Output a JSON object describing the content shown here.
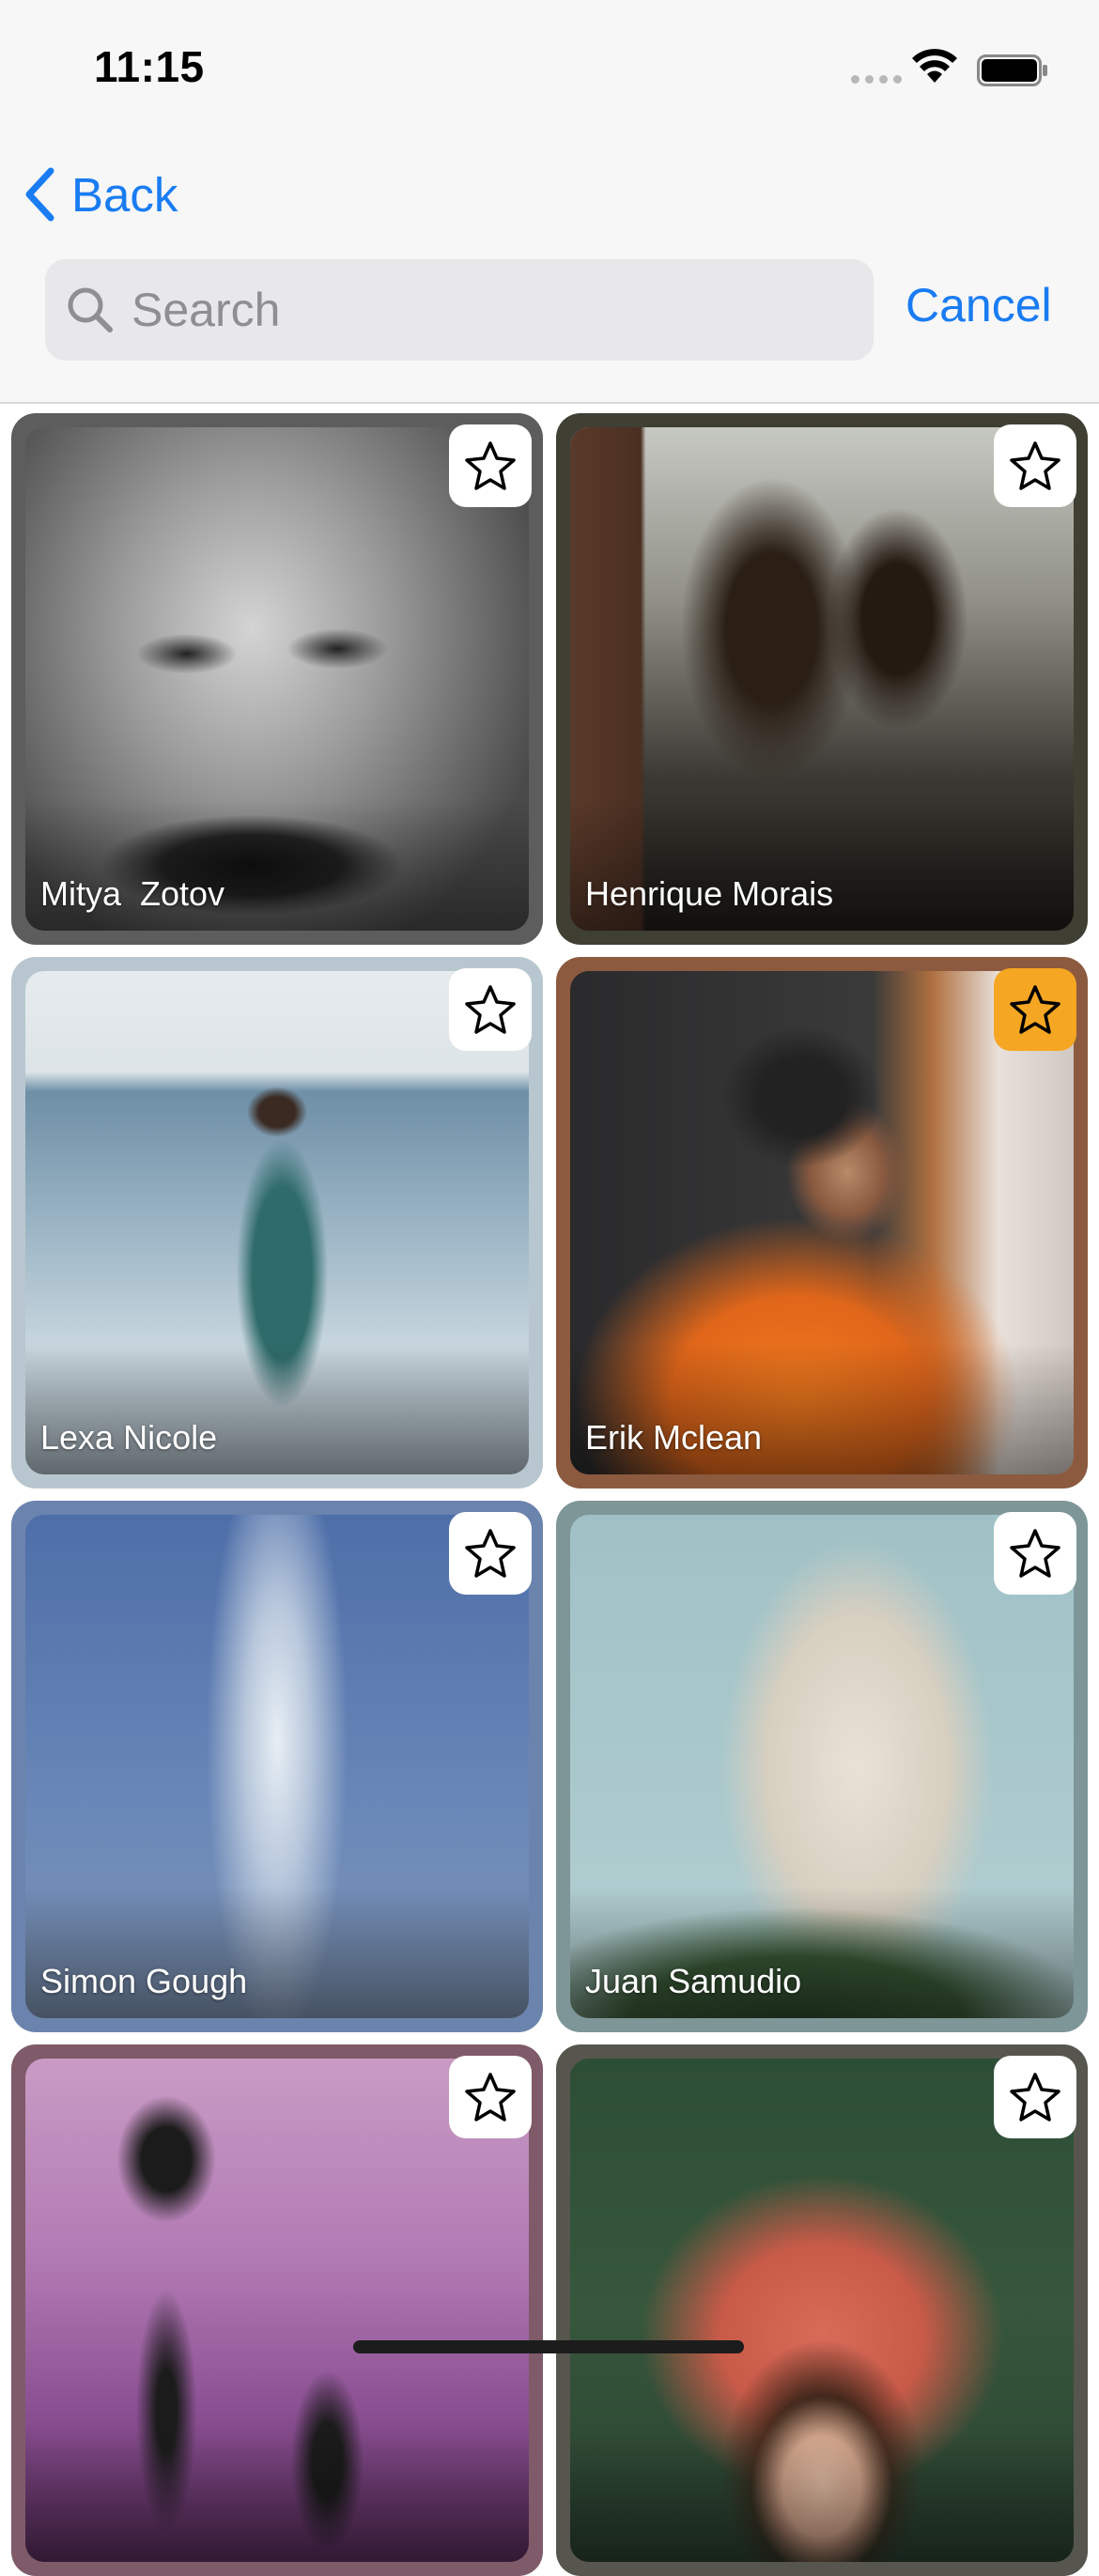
{
  "status_bar": {
    "time": "11:15"
  },
  "nav": {
    "back_label": "Back"
  },
  "search": {
    "placeholder": "Search",
    "value": "",
    "cancel_label": "Cancel"
  },
  "photos": [
    {
      "name": "Mitya  Zotov",
      "favorited": false,
      "frame_color": "#5d5d5d"
    },
    {
      "name": "Henrique Morais",
      "favorited": false,
      "frame_color": "#3f3f34"
    },
    {
      "name": "Lexa Nicole",
      "favorited": false,
      "frame_color": "#b8c7cf"
    },
    {
      "name": "Erik Mclean",
      "favorited": true,
      "frame_color": "#8c5a3f"
    },
    {
      "name": "Simon Gough",
      "favorited": false,
      "frame_color": "#6b84ad"
    },
    {
      "name": "Juan Samudio",
      "favorited": false,
      "frame_color": "#7f9698"
    },
    {
      "name": "",
      "favorited": false,
      "frame_color": "#7f5a69"
    },
    {
      "name": "",
      "favorited": false,
      "frame_color": "#56564e"
    }
  ],
  "colors": {
    "accent": "#1a7cf2",
    "favorite": "#f5a623"
  }
}
